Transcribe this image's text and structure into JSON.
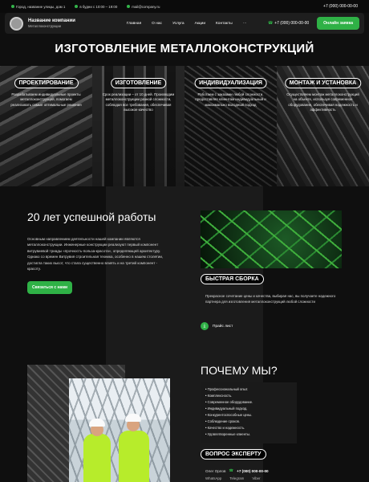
{
  "topbar": {
    "address": "Город, название улицы, дом 1",
    "hours": "в будни с 10:00 – 19:00",
    "email": "mail@company.ru",
    "phone": "+7 (000) 000-00-00"
  },
  "nav": {
    "company_name": "Название компании",
    "company_sub": "Металлоконструкции",
    "menu": [
      "Главная",
      "О нас",
      "Услуга",
      "Акции",
      "Контакты",
      "···"
    ],
    "cta": "Онлайн заявка"
  },
  "hero": {
    "title": "ИЗГОТОВЛЕНИЕ МЕТАЛЛОКОНСТРУКЦИЙ"
  },
  "services": [
    {
      "title": "ПРОЕКТИРОВАНИЕ",
      "text": "Разрабатываем индивидуальные проекты металлоконструкций, помогаем реализовать самые оптимальные решения"
    },
    {
      "title": "ИЗГОТОВЛЕНИЕ",
      "text": "Срок реализации – от 10 дней. Производим металлоконструкции разной сложности, соблюдая все требования, обеспечивая высокое качество"
    },
    {
      "title": "ИНДИВИДУАЛИЗАЦИЯ",
      "text": "Работаем с заказами любой сложности, предоставляя клиентам индивидуальный и максимально выгодный подход"
    },
    {
      "title": "МОНТАЖ И УСТАНОВКА",
      "text": "Осуществляем монтаж металлоконструкций на объекте, используя современное оборудование, обеспечивая надежность и эффективность"
    }
  ],
  "about": {
    "title": "20 лет успешной работы",
    "text": "Основным направлением деятельности нашей компании являются металлоконструкции. Инженерные конструкции реализуют первый компонент витрувиевой триады «прочность-польза-красота», определяющей архитектуру. Однако со времен Витрувия строительная техника, особенно в нашем столетии, достигла таких высот, что стала существенно влиять и на третий компонент - красоту.",
    "button": "Связаться с нами"
  },
  "fast": {
    "tag": "БЫСТРАЯ СБОРКА",
    "text": "Прекрасное сочетание цены и качества, выбирая нас, вы получаете надежного партнера для изготовления металлоконструкций любой сложности",
    "price_link": "Прайс лист"
  },
  "why": {
    "title": "ПОЧЕМУ МЫ?",
    "items": [
      "Профессиональный опыт.",
      "Комплексность.",
      "Современное оборудование.",
      "Индивидуальный подход.",
      "Конкурентоспособные цены.",
      "Соблюдение сроков.",
      "Качество и надежность.",
      "Удовлетворенные клиенты."
    ]
  },
  "expert": {
    "tag": "ВОПРОС ЭКСПЕРТУ",
    "name": "Олег Орлов",
    "phone": "+7 (000) 000-00-00",
    "messengers": [
      "WhatsApp",
      "Telegram",
      "Viber"
    ]
  },
  "colors": {
    "accent": "#2fb146",
    "bg": "#0f0f0f",
    "panel": "#1b1b1b"
  }
}
